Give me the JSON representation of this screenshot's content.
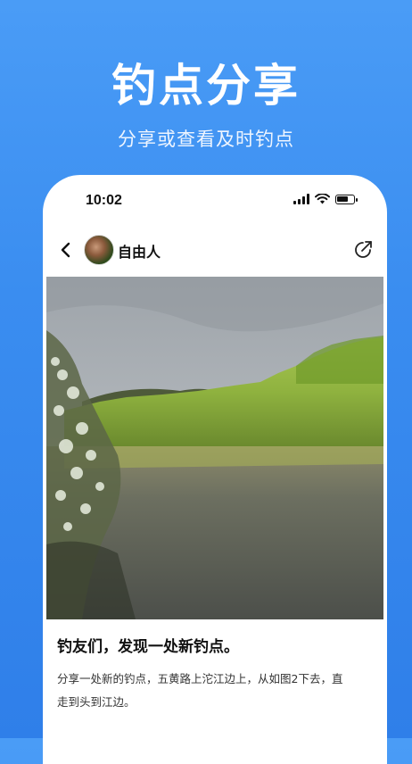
{
  "promo": {
    "title": "钓点分享",
    "subtitle": "分享或查看及时钓点"
  },
  "status_bar": {
    "time": "10:02",
    "icons": [
      "signal-icon",
      "wifi-icon",
      "battery-icon"
    ]
  },
  "nav": {
    "back_icon": "chevron-left-icon",
    "username": "自由人",
    "share_icon": "share-icon"
  },
  "post": {
    "title": "钓友们，发现一处新钓点。",
    "body": "分享一处新的钓点，五黄路上沱江边上，从如图2下去，直走到头到江边。"
  },
  "colors": {
    "background_top": "#4a9cf6",
    "background_bottom": "#2f7fe9",
    "card": "#ffffff"
  }
}
